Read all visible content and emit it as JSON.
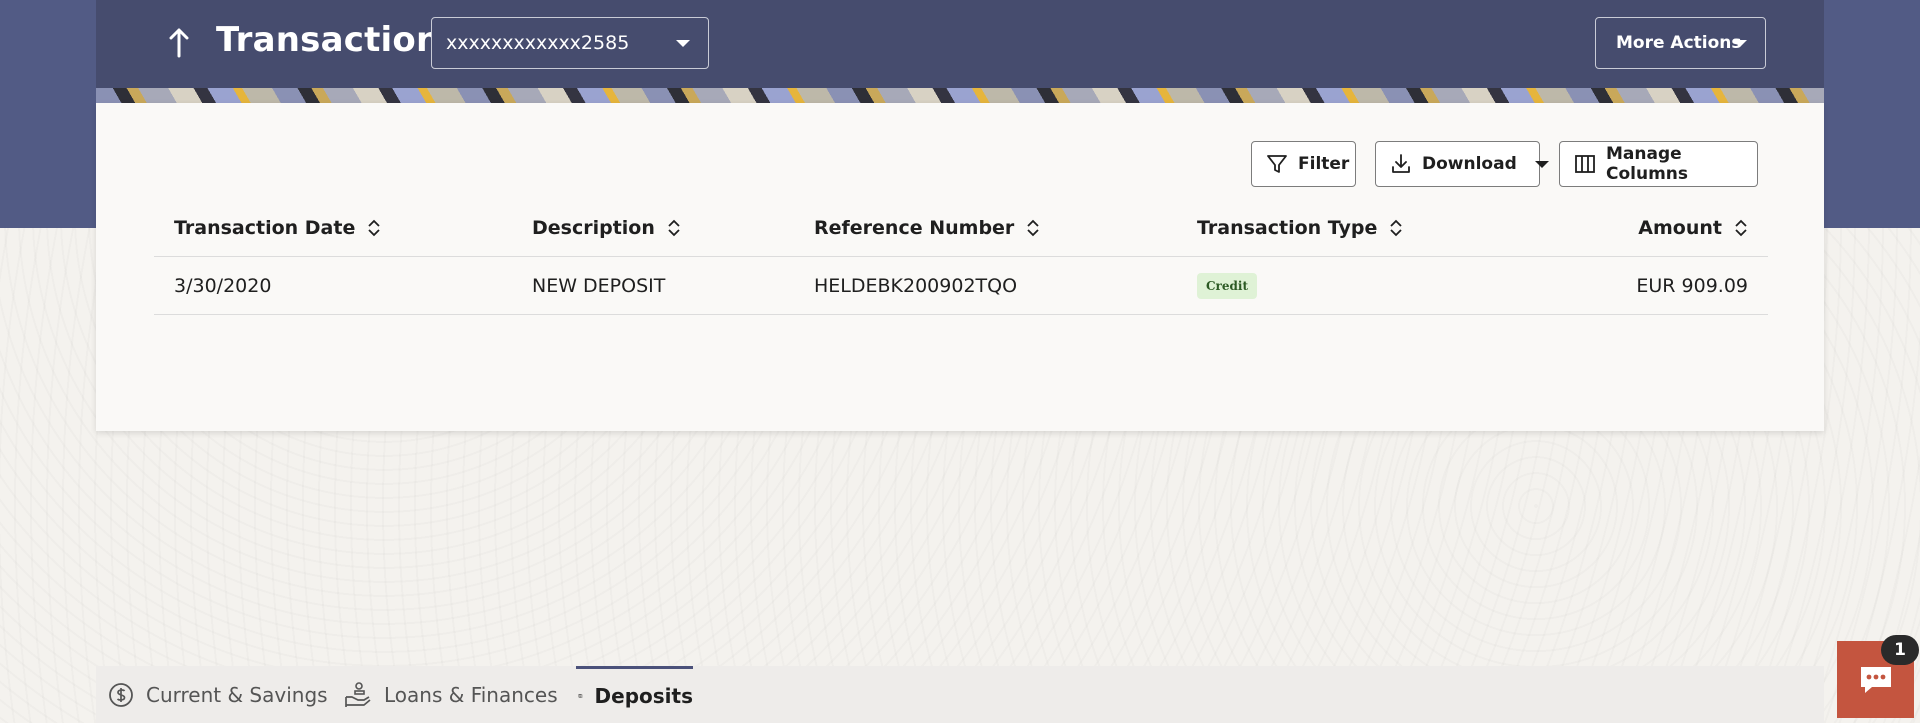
{
  "header": {
    "title": "Transactions",
    "account_number": "xxxxxxxxxxxx2585",
    "more_actions_label": "More Actions"
  },
  "toolbar": {
    "filter_label": "Filter",
    "download_label": "Download",
    "manage_columns_label": "Manage Columns"
  },
  "table": {
    "columns": [
      "Transaction Date",
      "Description",
      "Reference Number",
      "Transaction Type",
      "Amount"
    ],
    "rows": [
      {
        "date": "3/30/2020",
        "description": "NEW DEPOSIT",
        "reference": "HELDEBK200902TQO",
        "type": "Credit",
        "amount": "EUR 909.09"
      }
    ]
  },
  "bottom_tabs": [
    {
      "label": "Current & Savings",
      "icon": "dollar-circle-icon"
    },
    {
      "label": "Loans & Finances",
      "icon": "hand-coins-icon"
    },
    {
      "label": "Deposits",
      "icon": "deposits-icon",
      "active": true
    }
  ],
  "chat": {
    "unread_count": "1",
    "icon": "chat-bubble-icon"
  },
  "colors": {
    "header_bg": "#464c6e",
    "band_bg": "#525b85",
    "chat_bg": "#c4553f",
    "credit_badge_bg": "#dff2d6"
  }
}
